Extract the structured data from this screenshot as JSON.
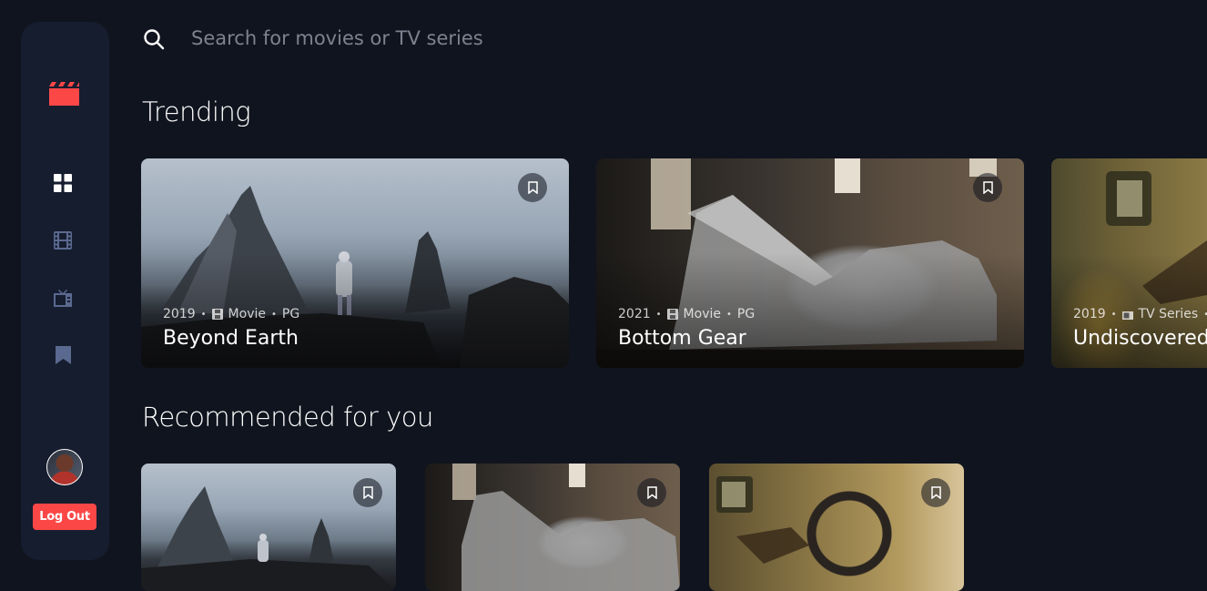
{
  "search": {
    "placeholder": "Search for movies or TV series"
  },
  "sidebar": {
    "logo_icon": "clapperboard-icon",
    "nav": [
      {
        "name": "home",
        "icon": "grid-icon",
        "active": true
      },
      {
        "name": "movies",
        "icon": "film-icon",
        "active": false
      },
      {
        "name": "tv-series",
        "icon": "tv-icon",
        "active": false
      },
      {
        "name": "bookmarks",
        "icon": "bookmark-icon",
        "active": false
      }
    ],
    "logout_label": "Log Out"
  },
  "sections": {
    "trending_title": "Trending",
    "recommended_title": "Recommended for you"
  },
  "trending": [
    {
      "year": "2019",
      "category": "Movie",
      "rating": "PG",
      "title": "Beyond Earth"
    },
    {
      "year": "2021",
      "category": "Movie",
      "rating": "PG",
      "title": "Bottom Gear"
    },
    {
      "year": "2019",
      "category": "TV Series",
      "rating": "",
      "title": "Undiscovered Cities"
    }
  ],
  "colors": {
    "background": "#10141E",
    "sidebar": "#161D2F",
    "accent": "#FC4747",
    "muted": "#5A698F"
  }
}
